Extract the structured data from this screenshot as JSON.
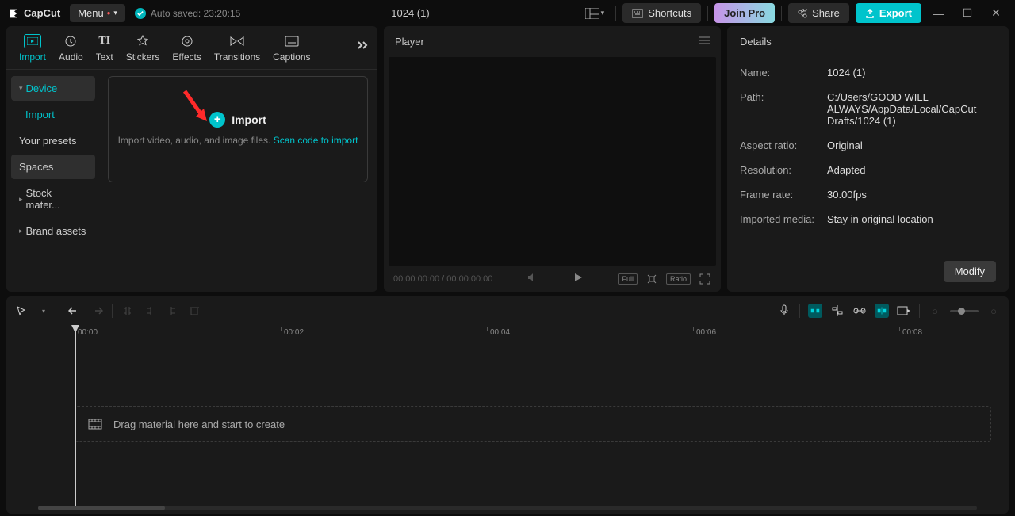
{
  "titlebar": {
    "app_name": "CapCut",
    "menu_label": "Menu",
    "autosave": "Auto saved: 23:20:15",
    "project_title": "1024 (1)",
    "shortcuts": "Shortcuts",
    "join_pro": "Join Pro",
    "share": "Share",
    "export": "Export"
  },
  "media_tabs": [
    "Import",
    "Audio",
    "Text",
    "Stickers",
    "Effects",
    "Transitions",
    "Captions"
  ],
  "media_side": {
    "device": "Device",
    "import": "Import",
    "presets": "Your presets",
    "spaces": "Spaces",
    "stock": "Stock mater...",
    "brand": "Brand assets"
  },
  "import_box": {
    "title": "Import",
    "desc_prefix": "Import video, audio, and image files. ",
    "scan_link": "Scan code to import"
  },
  "player": {
    "title": "Player",
    "time": "00:00:00:00 / 00:00:00:00",
    "full": "Full",
    "ratio": "Ratio"
  },
  "details": {
    "title": "Details",
    "rows": [
      {
        "label": "Name:",
        "value": "1024 (1)"
      },
      {
        "label": "Path:",
        "value": "C:/Users/GOOD WILL ALWAYS/AppData/Local/CapCut Drafts/1024 (1)"
      },
      {
        "label": "Aspect ratio:",
        "value": "Original"
      },
      {
        "label": "Resolution:",
        "value": "Adapted"
      },
      {
        "label": "Frame rate:",
        "value": "30.00fps"
      },
      {
        "label": "Imported media:",
        "value": "Stay in original location"
      }
    ],
    "modify": "Modify"
  },
  "timeline": {
    "ticks": [
      "00:00",
      "00:02",
      "00:04",
      "00:06",
      "00:08"
    ],
    "drop_hint": "Drag material here and start to create"
  }
}
